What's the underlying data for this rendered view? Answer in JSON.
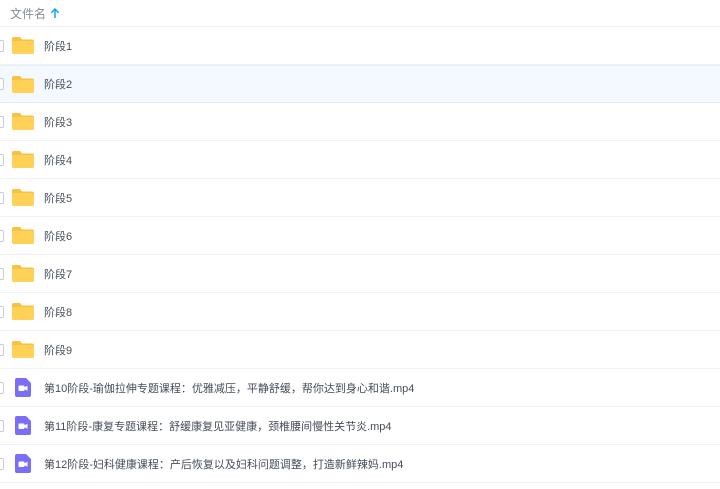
{
  "header": {
    "column_label": "文件名",
    "sort_direction": "ascending",
    "sort_icon": "arrow-up-icon",
    "sort_color": "#06a7ff"
  },
  "colors": {
    "folder": "#ffd257",
    "folder_back": "#f7c244",
    "video": "#7b6ef6",
    "hover_row": "#f4f9ff"
  },
  "files": [
    {
      "name": "阶段1",
      "type": "folder",
      "icon": "folder-icon"
    },
    {
      "name": "阶段2",
      "type": "folder",
      "icon": "folder-icon",
      "hovered": true
    },
    {
      "name": "阶段3",
      "type": "folder",
      "icon": "folder-icon"
    },
    {
      "name": "阶段4",
      "type": "folder",
      "icon": "folder-icon"
    },
    {
      "name": "阶段5",
      "type": "folder",
      "icon": "folder-icon"
    },
    {
      "name": "阶段6",
      "type": "folder",
      "icon": "folder-icon"
    },
    {
      "name": "阶段7",
      "type": "folder",
      "icon": "folder-icon"
    },
    {
      "name": "阶段8",
      "type": "folder",
      "icon": "folder-icon"
    },
    {
      "name": "阶段9",
      "type": "folder",
      "icon": "folder-icon"
    },
    {
      "name": "第10阶段-瑜伽拉伸专题课程：优雅减压，平静舒缓，帮你达到身心和谐.mp4",
      "type": "video",
      "icon": "video-file-icon"
    },
    {
      "name": "第11阶段-康复专题课程：舒缓康复见亚健康，颈椎腰间慢性关节炎.mp4",
      "type": "video",
      "icon": "video-file-icon"
    },
    {
      "name": "第12阶段-妇科健康课程：产后恢复以及妇科问题调整，打造新鲜辣妈.mp4",
      "type": "video",
      "icon": "video-file-icon"
    }
  ]
}
